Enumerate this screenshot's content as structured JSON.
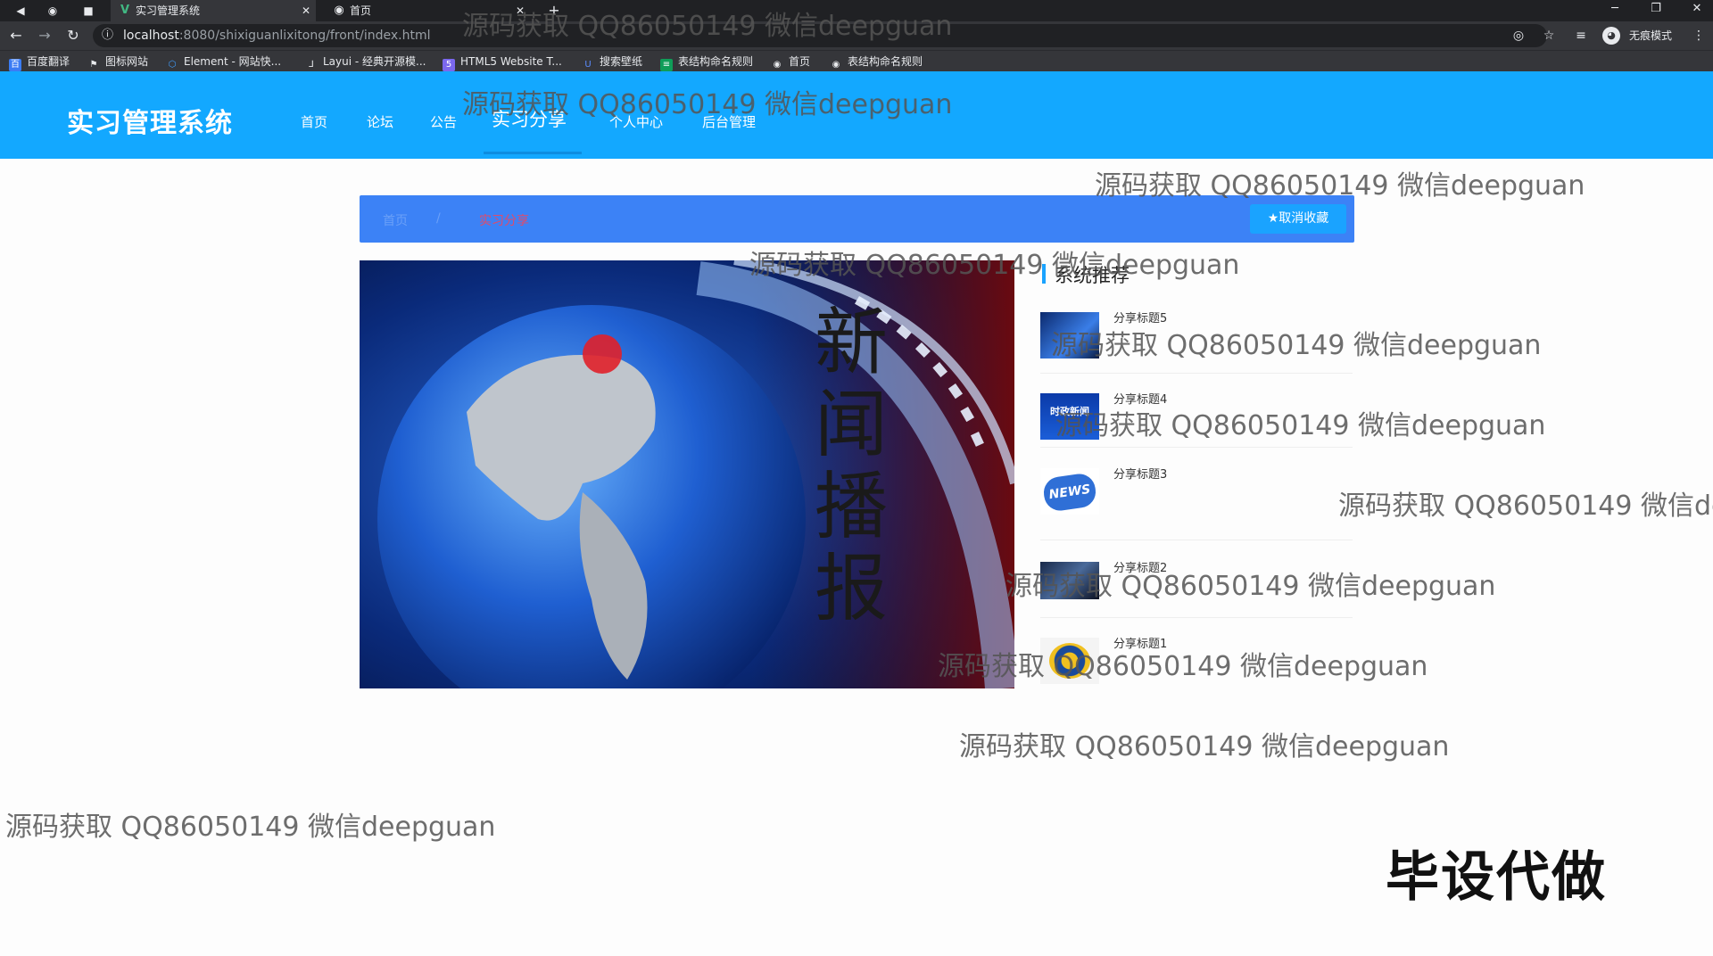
{
  "browser": {
    "tabs": [
      {
        "label": "实习管理系统",
        "icon": "vue-logo-icon",
        "active": true
      },
      {
        "label": "首页",
        "icon": "globe-icon",
        "active": false
      }
    ],
    "new_tab_symbol": "+",
    "url_host": "localhost",
    "url_rest": ":8080/shixiguanlixitong/front/index.html",
    "incognito_label": "无痕模式",
    "bookmarks": [
      {
        "label": "百度翻译",
        "icon": "translate-icon",
        "color": "#3b7cf4"
      },
      {
        "label": "图标网站",
        "icon": "flag-icon",
        "color": "#e8eaed"
      },
      {
        "label": "Element - 网站快...",
        "icon": "element-icon",
        "color": "#409eff"
      },
      {
        "label": "Layui - 经典开源模...",
        "icon": "layui-icon",
        "color": "#e8eaed"
      },
      {
        "label": "HTML5 Website T...",
        "icon": "html5-icon",
        "color": "#7b68ee"
      },
      {
        "label": "搜索壁纸",
        "icon": "wallpaper-icon",
        "color": "#5b8cff"
      },
      {
        "label": "表结构命名规则",
        "icon": "sheet-icon",
        "color": "#0f9d58"
      },
      {
        "label": "首页",
        "icon": "globe-icon",
        "color": "#e8eaed"
      },
      {
        "label": "表结构命名规则",
        "icon": "globe-icon",
        "color": "#e8eaed"
      }
    ]
  },
  "site": {
    "title": "实习管理系统",
    "nav": [
      {
        "label": "首页",
        "active": false
      },
      {
        "label": "论坛",
        "active": false
      },
      {
        "label": "公告",
        "active": false
      },
      {
        "label": "实习分享",
        "active": true
      },
      {
        "label": "个人中心",
        "active": false
      },
      {
        "label": "后台管理",
        "active": false
      }
    ],
    "header_color": "#13a8ff"
  },
  "breadcrumb": {
    "home": "首页",
    "separator": "/",
    "current": "实习分享",
    "favorite_button": "取消收藏"
  },
  "hero": {
    "caption": "新闻播报"
  },
  "recommend": {
    "title": "系统推荐",
    "items": [
      {
        "label": "分享标题5",
        "thumb": "blue-scene"
      },
      {
        "label": "分享标题4",
        "thumb": "news-banner",
        "thumb_text": "时政新闻"
      },
      {
        "label": "分享标题3",
        "thumb": "news-bubble",
        "thumb_text": "NEWS"
      },
      {
        "label": "分享标题2",
        "thumb": "dark-scene"
      },
      {
        "label": "分享标题1",
        "thumb": "emblem"
      }
    ]
  },
  "watermark": {
    "text": "源码获取 QQ86050149 微信deepguan",
    "stamp": "毕设代做"
  }
}
